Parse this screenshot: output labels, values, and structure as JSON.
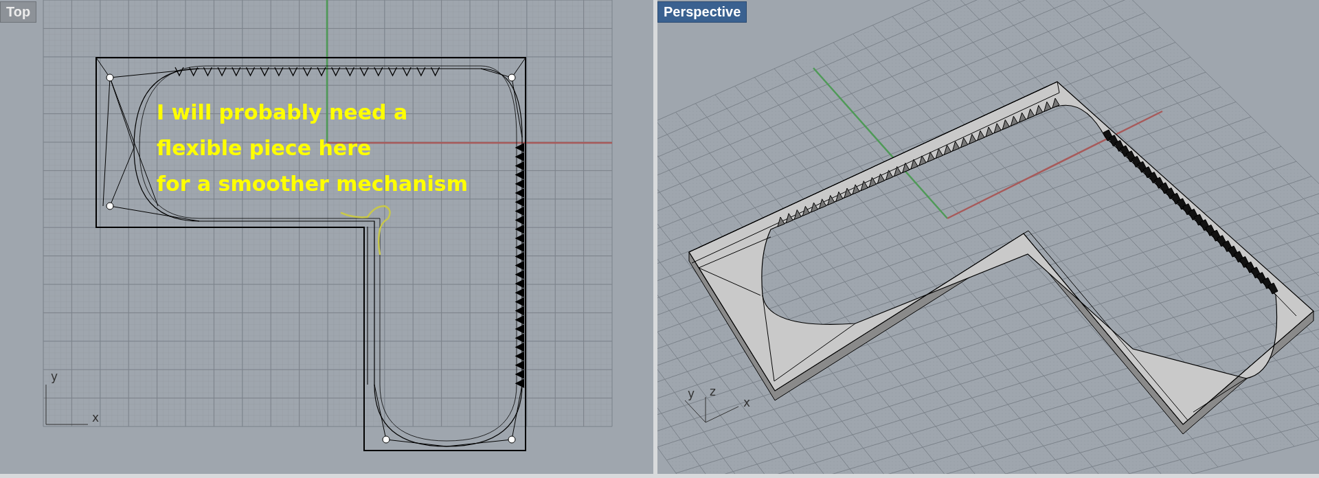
{
  "viewports": [
    {
      "kind": "top",
      "label": "Top",
      "selected": false,
      "axis_labels": [
        "y",
        "x"
      ],
      "annotation": "I will probably need a\nflexible piece here\nfor a smoother mechanism"
    },
    {
      "kind": "perspective",
      "label": "Perspective",
      "selected": true,
      "axis_labels": [
        "y",
        "z",
        "x"
      ]
    }
  ]
}
